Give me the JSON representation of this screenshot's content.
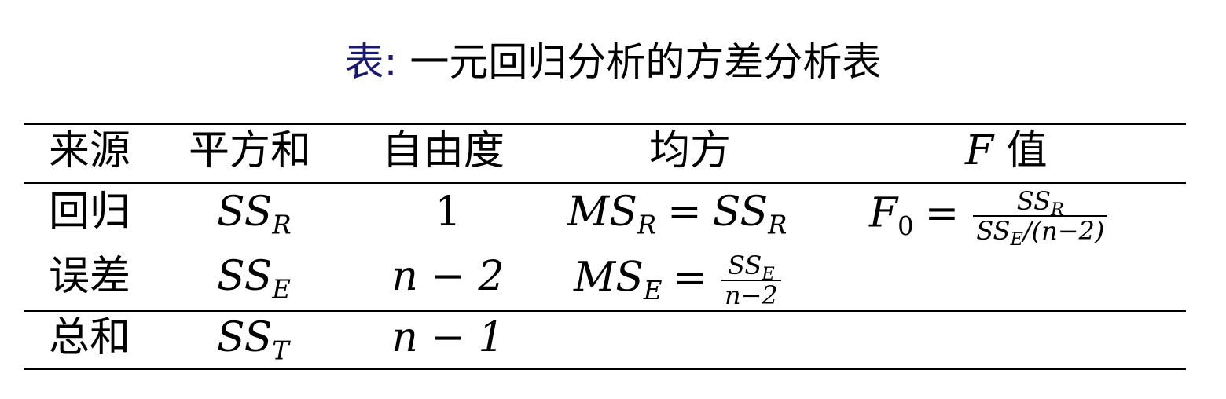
{
  "caption": {
    "label": "表:",
    "text": "一元回归分析的方差分析表"
  },
  "table": {
    "headers": [
      "来源",
      "平方和",
      "自由度",
      "均方",
      "值"
    ],
    "header_f_symbol": "F",
    "rows": [
      {
        "source": "回归",
        "ss_sym": "SS",
        "ss_sub": "R",
        "df": "1",
        "ms_sym": "MS",
        "ms_sub": "R",
        "ms_eq": "=",
        "ms_rhs_sym": "SS",
        "ms_rhs_sub": "R",
        "f_sym": "F",
        "f_sub": "0",
        "f_eq": "=",
        "f_num_sym": "SS",
        "f_num_sub": "R",
        "f_den_sym": "SS",
        "f_den_sub": "E",
        "f_den_rest": "/(n−2)"
      },
      {
        "source": "误差",
        "ss_sym": "SS",
        "ss_sub": "E",
        "df": "n − 2",
        "ms_sym": "MS",
        "ms_sub": "E",
        "ms_eq": "=",
        "ms_num_sym": "SS",
        "ms_num_sub": "E",
        "ms_den": "n−2"
      },
      {
        "source": "总和",
        "ss_sym": "SS",
        "ss_sub": "T",
        "df": "n − 1"
      }
    ]
  }
}
